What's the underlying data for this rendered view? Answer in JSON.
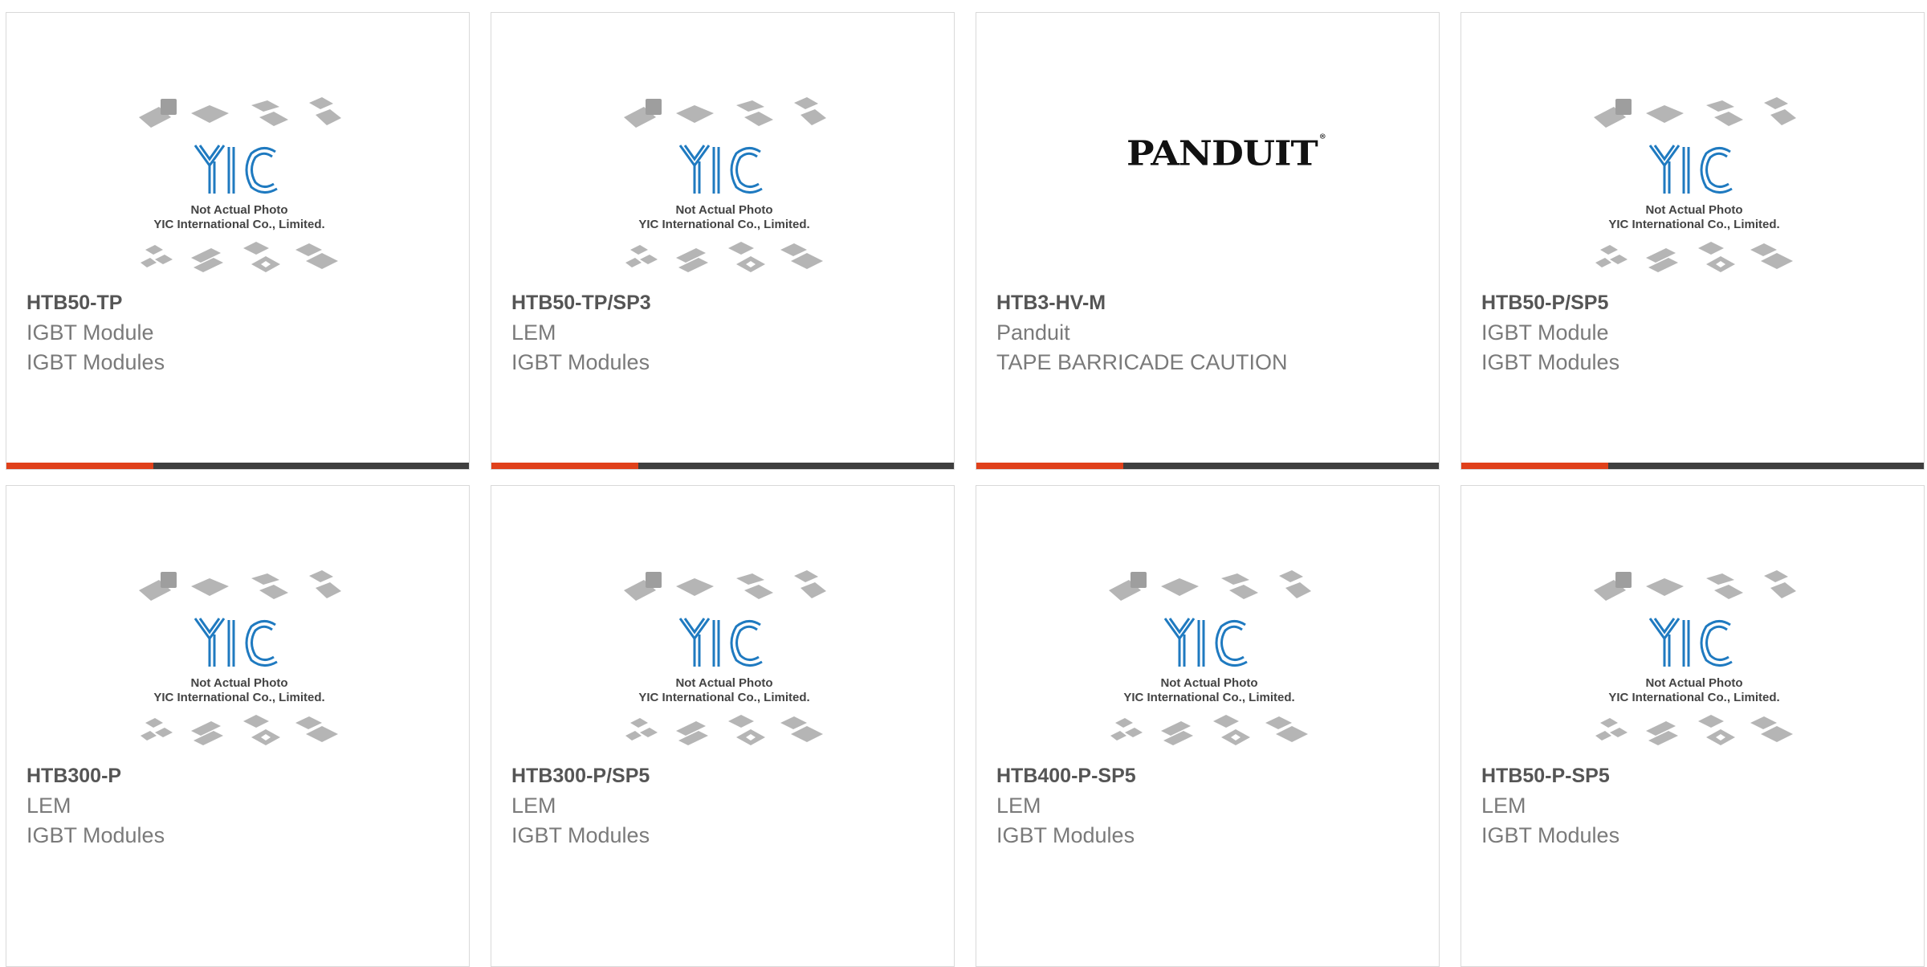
{
  "accent_color": "#e0401a",
  "bar_color": "#3e3e3e",
  "placeholder": {
    "line1": "Not Actual Photo",
    "line2": "YIC International Co., Limited.",
    "logo": "YIC"
  },
  "cards": [
    {
      "part": "HTB50-TP",
      "line1": "IGBT Module",
      "line2": "IGBT Modules",
      "image": "yic-placeholder"
    },
    {
      "part": "HTB50-TP/SP3",
      "line1": "LEM",
      "line2": "IGBT Modules",
      "image": "yic-placeholder"
    },
    {
      "part": "HTB3-HV-M",
      "line1": "Panduit",
      "line2": "TAPE BARRICADE CAUTION",
      "image": "panduit-logo",
      "logo_text": "PANDUIT"
    },
    {
      "part": "HTB50-P/SP5",
      "line1": "IGBT Module",
      "line2": "IGBT Modules",
      "image": "yic-placeholder"
    },
    {
      "part": "HTB300-P",
      "line1": "LEM",
      "line2": "IGBT Modules",
      "image": "yic-placeholder"
    },
    {
      "part": "HTB300-P/SP5",
      "line1": "LEM",
      "line2": "IGBT Modules",
      "image": "yic-placeholder"
    },
    {
      "part": "HTB400-P-SP5",
      "line1": "LEM",
      "line2": "IGBT Modules",
      "image": "yic-placeholder"
    },
    {
      "part": "HTB50-P-SP5",
      "line1": "LEM",
      "line2": "IGBT Modules",
      "image": "yic-placeholder"
    }
  ]
}
